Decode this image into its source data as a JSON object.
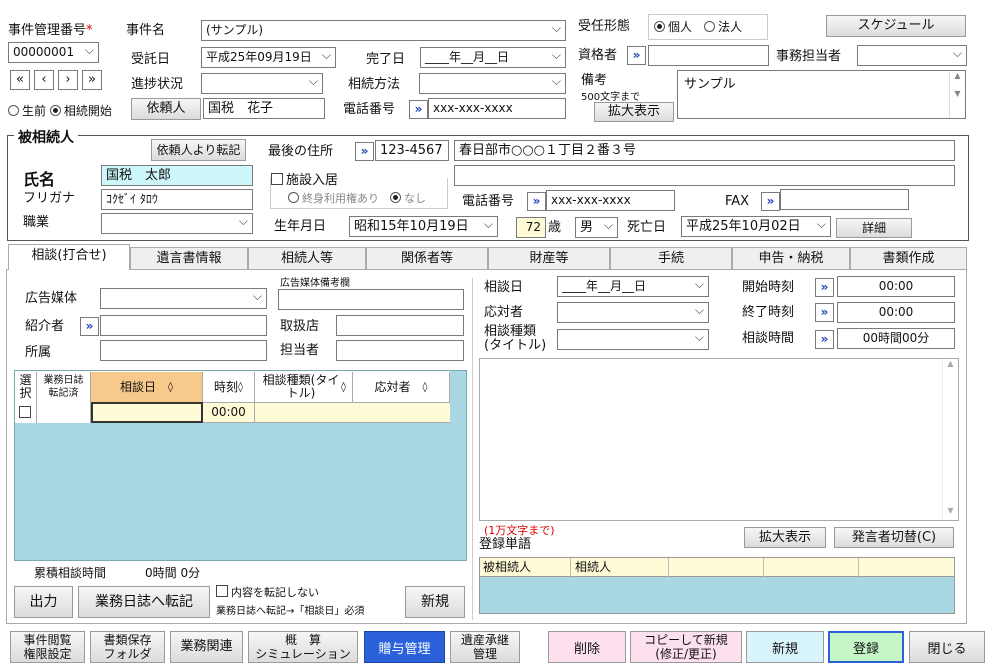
{
  "header": {
    "case_no_label": "事件管理番号",
    "req_mark": "*",
    "case_no": "00000001",
    "case_name_label": "事件名",
    "case_name": "(サンプル)",
    "accept_form_label": "受任形態",
    "accept_personal": "個人",
    "accept_corp": "法人",
    "schedule_btn": "スケジュール",
    "consign_label": "受託日",
    "consign_date": "平成25年09月19日",
    "complete_label": "完了日",
    "complete_date": "____年__月__日",
    "qualifier_label": "資格者",
    "office_staff_label": "事務担当者",
    "progress_label": "進捗状況",
    "inherit_method_label": "相続方法",
    "remarks_label": "備考",
    "remarks_limit": "500文字まで",
    "remarks_value": "サンプル",
    "expand_btn": "拡大表示",
    "nav": [
      "«",
      "‹",
      "›",
      "»"
    ],
    "before_death": "生前",
    "inherit_start": "相続開始",
    "client_btn": "依頼人",
    "client_name": "国税　花子",
    "phone_label": "電話番号",
    "phone_value": "xxx-xxx-xxxx"
  },
  "decedent": {
    "section_label": "被相続人",
    "transfer_btn": "依頼人より転記",
    "name_label": "氏名",
    "name": "国税　太郎",
    "kana_label": "フリガナ",
    "kana": "ｺｸｾﾞｲ ﾀﾛｳ",
    "job_label": "職業",
    "last_addr_label": "最後の住所",
    "postal": "123-4567",
    "address": "春日部市○○○１丁目２番３号",
    "facility_label": "施設入居",
    "lifetime_label": "終身利用権あり",
    "none_label": "なし",
    "phone_label": "電話番号",
    "phone": "xxx-xxx-xxxx",
    "fax_label": "FAX",
    "birth_label": "生年月日",
    "birth": "昭和15年10月19日",
    "age": "72",
    "age_unit": "歳",
    "gender": "男",
    "death_label": "死亡日",
    "death": "平成25年10月02日",
    "detail_btn": "詳細"
  },
  "tabs": [
    "相談(打合せ)",
    "遺言書情報",
    "相続人等",
    "関係者等",
    "財産等",
    "手続",
    "申告・納税",
    "書類作成"
  ],
  "consult": {
    "ad_media_label": "広告媒体",
    "ad_note_label": "広告媒体備考欄",
    "referrer_label": "紹介者",
    "agency_label": "取扱店",
    "affiliation_label": "所属",
    "person_label": "担当者",
    "columns": [
      "選択",
      "業務日誌転記済",
      "相談日",
      "時刻",
      "相談種類(タイトル)",
      "応対者"
    ],
    "row_time": "00:00",
    "total_label": "累積相談時間",
    "total_value": "0時間 0分",
    "output_btn": "出力",
    "journal_btn": "業務日誌へ転記",
    "no_transfer_label": "内容を転記しない",
    "transfer_note": "業務日誌へ転記→「相談日」必須",
    "new_btn": "新規",
    "date_label": "相談日",
    "date_value": "____年__月__日",
    "start_label": "開始時刻",
    "start_value": "00:00",
    "responder_label": "応対者",
    "end_label": "終了時刻",
    "end_value": "00:00",
    "type_label": "相談種類",
    "type_sub": "(タイトル)",
    "duration_label": "相談時間",
    "duration_value": "00時間00分",
    "limit_note": "(1万文字まで)",
    "words_label": "登録単語",
    "expand_btn": "拡大表示",
    "speaker_btn": "発言者切替(C)",
    "word_cols": [
      "被相続人",
      "相続人"
    ]
  },
  "bottom": {
    "b1": [
      "事件閲覧",
      "権限設定"
    ],
    "b2": [
      "書類保存",
      "フォルダ"
    ],
    "b3": "業務関連",
    "b4": [
      "概　算",
      "シミュレーション"
    ],
    "b5": "贈与管理",
    "b6": [
      "遺産承継",
      "管理"
    ],
    "delete": "削除",
    "copy": [
      "コピーして新規",
      "(修正/更正)"
    ],
    "new": "新規",
    "register": "登録",
    "close": "閉じる"
  },
  "colors": {
    "accent_blue": "#2b62d9",
    "grid_bg": "#a9d7e4",
    "header_orange": "#f7c98b",
    "cream": "#fffbd6",
    "cyan": "#cdf7fb"
  }
}
